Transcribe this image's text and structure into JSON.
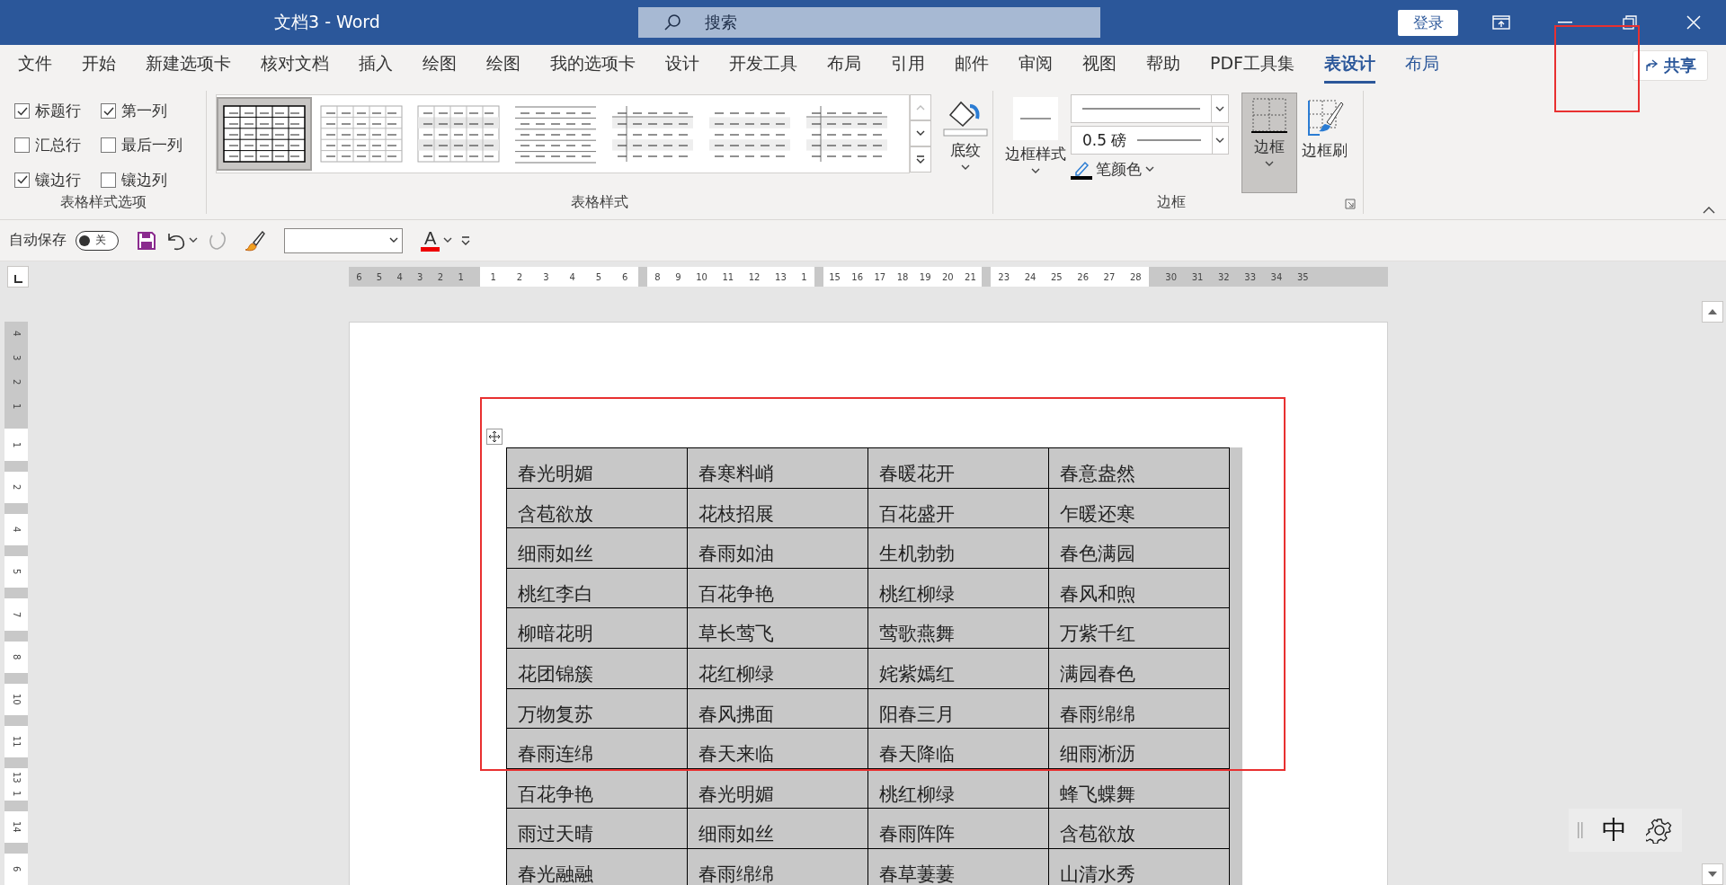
{
  "window": {
    "title": "文档3  -  Word",
    "sign_in": "登录"
  },
  "search": {
    "placeholder": "搜索"
  },
  "menu_tabs": [
    {
      "label": "文件",
      "selected": false,
      "contextual": false
    },
    {
      "label": "开始",
      "selected": false,
      "contextual": false
    },
    {
      "label": "新建选项卡",
      "selected": false,
      "contextual": false
    },
    {
      "label": "核对文档",
      "selected": false,
      "contextual": false
    },
    {
      "label": "插入",
      "selected": false,
      "contextual": false
    },
    {
      "label": "绘图",
      "selected": false,
      "contextual": false
    },
    {
      "label": "绘图",
      "selected": false,
      "contextual": false
    },
    {
      "label": "我的选项卡",
      "selected": false,
      "contextual": false
    },
    {
      "label": "设计",
      "selected": false,
      "contextual": false
    },
    {
      "label": "开发工具",
      "selected": false,
      "contextual": false
    },
    {
      "label": "布局",
      "selected": false,
      "contextual": false
    },
    {
      "label": "引用",
      "selected": false,
      "contextual": false
    },
    {
      "label": "邮件",
      "selected": false,
      "contextual": false
    },
    {
      "label": "审阅",
      "selected": false,
      "contextual": false
    },
    {
      "label": "视图",
      "selected": false,
      "contextual": false
    },
    {
      "label": "帮助",
      "selected": false,
      "contextual": false
    },
    {
      "label": "PDF工具集",
      "selected": false,
      "contextual": false
    },
    {
      "label": "表设计",
      "selected": true,
      "contextual": true
    },
    {
      "label": "布局",
      "selected": false,
      "contextual": true
    }
  ],
  "share": "共享",
  "table_style_options": {
    "label": "表格样式选项",
    "options": [
      {
        "label": "标题行",
        "checked": true
      },
      {
        "label": "第一列",
        "checked": true
      },
      {
        "label": "汇总行",
        "checked": false
      },
      {
        "label": "最后一列",
        "checked": false
      },
      {
        "label": "镶边行",
        "checked": true
      },
      {
        "label": "镶边列",
        "checked": false
      }
    ]
  },
  "table_styles": {
    "label": "表格样式",
    "shading": "底纹",
    "styles": [
      {
        "kind": "grid",
        "selected": true
      },
      {
        "kind": "light-grid",
        "selected": false
      },
      {
        "kind": "shaded-grid",
        "selected": false
      },
      {
        "kind": "lines",
        "selected": false
      },
      {
        "kind": "banded-first-column",
        "selected": false
      },
      {
        "kind": "banded",
        "selected": false
      },
      {
        "kind": "banded-first-column",
        "selected": false
      }
    ]
  },
  "borders": {
    "label": "边框",
    "border_styles": "边框样式",
    "line_weight": "0.5 磅",
    "pen_color": "笔颜色",
    "borders_button": {
      "label": "边框",
      "pressed": true
    },
    "border_painter": "边框刷"
  },
  "quick_access": {
    "autosave_label": "自动保存",
    "autosave": {
      "on": false,
      "text": "关"
    },
    "font_color_letter": "A",
    "redo_disabled": true
  },
  "horizontal_ruler": [
    {
      "shaded": true,
      "labels": [
        "6",
        "5",
        "4",
        "3",
        "2",
        "1"
      ]
    },
    {
      "shaded": false,
      "labels": [
        "1",
        "2",
        "3",
        "4",
        "5",
        "6"
      ]
    },
    {
      "shaded": false,
      "labels": [
        "8",
        "9",
        "10",
        "11",
        "12",
        "13",
        "1"
      ]
    },
    {
      "shaded": false,
      "labels": [
        "15",
        "16",
        "17",
        "18",
        "19",
        "20",
        "21"
      ]
    },
    {
      "shaded": false,
      "labels": [
        "23",
        "24",
        "25",
        "26",
        "27",
        "28"
      ]
    },
    {
      "shaded": true,
      "labels": [
        "30",
        "31",
        "32",
        "33",
        "34",
        "35"
      ]
    }
  ],
  "vertical_ruler": [
    {
      "shaded": true,
      "labels": [
        "4",
        "3",
        "2",
        "1"
      ]
    },
    {
      "shaded": false,
      "labels": [
        "1"
      ]
    },
    {
      "shaded": false,
      "labels": [
        "2"
      ]
    },
    {
      "shaded": false,
      "labels": [
        "4"
      ]
    },
    {
      "shaded": false,
      "labels": [
        "5"
      ]
    },
    {
      "shaded": false,
      "labels": [
        "7"
      ]
    },
    {
      "shaded": false,
      "labels": [
        "8"
      ]
    },
    {
      "shaded": false,
      "labels": [
        "10"
      ]
    },
    {
      "shaded": false,
      "labels": [
        "11"
      ]
    },
    {
      "shaded": false,
      "labels": [
        "13",
        "1"
      ]
    },
    {
      "shaded": false,
      "labels": [
        "14"
      ]
    },
    {
      "shaded": false,
      "labels": [
        "6"
      ]
    }
  ],
  "table": {
    "rows": [
      [
        "春光明媚",
        "春寒料峭",
        "春暖花开",
        "春意盎然"
      ],
      [
        "含苞欲放",
        "花枝招展",
        "百花盛开",
        "乍暖还寒"
      ],
      [
        "细雨如丝",
        "春雨如油",
        "生机勃勃",
        "春色满园"
      ],
      [
        "桃红李白",
        "百花争艳",
        "桃红柳绿",
        "春风和煦"
      ],
      [
        "柳暗花明",
        "草长莺飞",
        "莺歌燕舞",
        "万紫千红"
      ],
      [
        "花团锦簇",
        "花红柳绿",
        "姹紫嫣红",
        "满园春色"
      ],
      [
        "万物复苏",
        "春风拂面",
        "阳春三月",
        "春雨绵绵"
      ],
      [
        "春雨连绵",
        "春天来临",
        "春天降临",
        "细雨淅沥"
      ],
      [
        "百花争艳",
        "春光明媚",
        "桃红柳绿",
        "蜂飞蝶舞"
      ],
      [
        "雨过天晴",
        "细雨如丝",
        "春雨阵阵",
        "含苞欲放"
      ],
      [
        "春光融融",
        "春雨绵绵",
        "春草萋萋",
        "山清水秀"
      ]
    ]
  },
  "ime": {
    "mode": "中"
  }
}
